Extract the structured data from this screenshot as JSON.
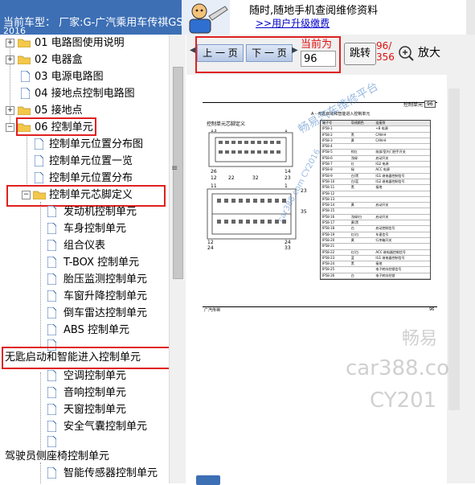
{
  "header": {
    "vehicle_label": "当前车型： 厂家:G-广汽乘用车传祺GS",
    "vehicle_year": "2016",
    "promo_line1": "随时,随地手机查阅维修资料",
    "promo_link": ">>用户升级缴费"
  },
  "tree": {
    "items": [
      {
        "label": "01 电路图使用说明"
      },
      {
        "label": "02 电器盒"
      },
      {
        "label": "03 电源电路图"
      },
      {
        "label": "04 接地点控制电路图"
      },
      {
        "label": "05 接地点"
      },
      {
        "label": "06 控制单元"
      },
      {
        "label": "控制单元位置分布图"
      },
      {
        "label": "控制单元位置一览"
      },
      {
        "label": "控制单元位置分布"
      },
      {
        "label": "控制单元芯脚定义"
      },
      {
        "label": "发动机控制单元"
      },
      {
        "label": "车身控制单元"
      },
      {
        "label": "组合仪表"
      },
      {
        "label": "T-BOX 控制单元"
      },
      {
        "label": "胎压监测控制单元"
      },
      {
        "label": "车窗升降控制单元"
      },
      {
        "label": "倒车雷达控制单元"
      },
      {
        "label": "ABS 控制单元"
      },
      {
        "label": ""
      },
      {
        "label": "无匙启动和智能进入控制单元"
      },
      {
        "label": "空调控制单元"
      },
      {
        "label": "音响控制单元"
      },
      {
        "label": "天窗控制单元"
      },
      {
        "label": "安全气囊控制单元"
      },
      {
        "label": ""
      },
      {
        "label": "驾驶员侧座椅控制单元"
      },
      {
        "label": "智能传感器控制单元"
      }
    ]
  },
  "toolbar": {
    "prev_label": "上 一 页",
    "next_label": "下 一 页",
    "current_label": "当前为",
    "page_value": "96",
    "jump_label": "跳转",
    "page_count": "96/\n356",
    "zoom_label": "放大"
  },
  "document": {
    "section_title": "A - 无匙启动和智能进入控制单元",
    "page_header_right": "控制单元",
    "page_number": "96",
    "sub_title": "控制单元芯脚定义",
    "footer_left": "广汽传祺",
    "footer_right": "96",
    "table_headers": [
      "端子号",
      "导线颜色",
      "连接到"
    ],
    "table_rows": [
      [
        "IP58-1",
        "",
        "+B 电源"
      ],
      [
        "IP58-2",
        "黑",
        "CAN-H"
      ],
      [
        "IP58-3",
        "黄",
        "CAN-H"
      ],
      [
        "IP58-4",
        "",
        ""
      ],
      [
        "IP58-5",
        "棕红",
        "前部/室内门把手开关"
      ],
      [
        "IP58-6",
        "浅绿",
        "启动开关"
      ],
      [
        "IP58-7",
        "红",
        "IG2 电源"
      ],
      [
        "IP58-8",
        "绿",
        "ACC 电源"
      ],
      [
        "IP58-9",
        "白/黑",
        "IG1 继电器控制信号"
      ],
      [
        "IP58-10",
        "白/蓝",
        "IG2 继电器控制信号"
      ],
      [
        "IP58-11",
        "黑",
        "接地"
      ],
      [
        "IP58-12",
        "",
        ""
      ],
      [
        "IP58-13",
        "",
        ""
      ],
      [
        "IP58-14",
        "黄",
        "启动开关"
      ],
      [
        "IP58-15",
        "",
        ""
      ],
      [
        "IP58-16",
        "浅绿/白",
        "启动开关"
      ],
      [
        "IP58-17",
        "黄/黑",
        ""
      ],
      [
        "IP58-18",
        "白",
        "启动控制信号"
      ],
      [
        "IP58-19",
        "红/白",
        "车速信号"
      ],
      [
        "IP58-20",
        "黄",
        "行李箱开关"
      ],
      [
        "IP58-21",
        "",
        ""
      ],
      [
        "IP58-22",
        "红/白",
        "ACC 继电器控制信号"
      ],
      [
        "IP58-23",
        "蓝",
        "IG1 继电器控制信号"
      ],
      [
        "IP58-24",
        "黑",
        "接地"
      ],
      [
        "IP58-25",
        "",
        "电子转向柱锁信号"
      ],
      [
        "IP58-26",
        "白",
        "电子转向柱锁"
      ]
    ],
    "pin_labels": [
      "13",
      "1",
      "26",
      "14",
      "12",
      "22",
      "32",
      "23",
      "11",
      "1",
      "23",
      "35",
      "12",
      "24",
      "24",
      "33"
    ],
    "watermarks": [
      "畅易汽车维修平台",
      "car388.com CY2016",
      "畅易",
      "car388.co",
      "CY201"
    ]
  },
  "colors": {
    "header_blue": "#3d6fb5",
    "highlight_red": "#e02020",
    "folder_yellow": "#f3c84a",
    "doc_blue": "#3a6ab0"
  }
}
